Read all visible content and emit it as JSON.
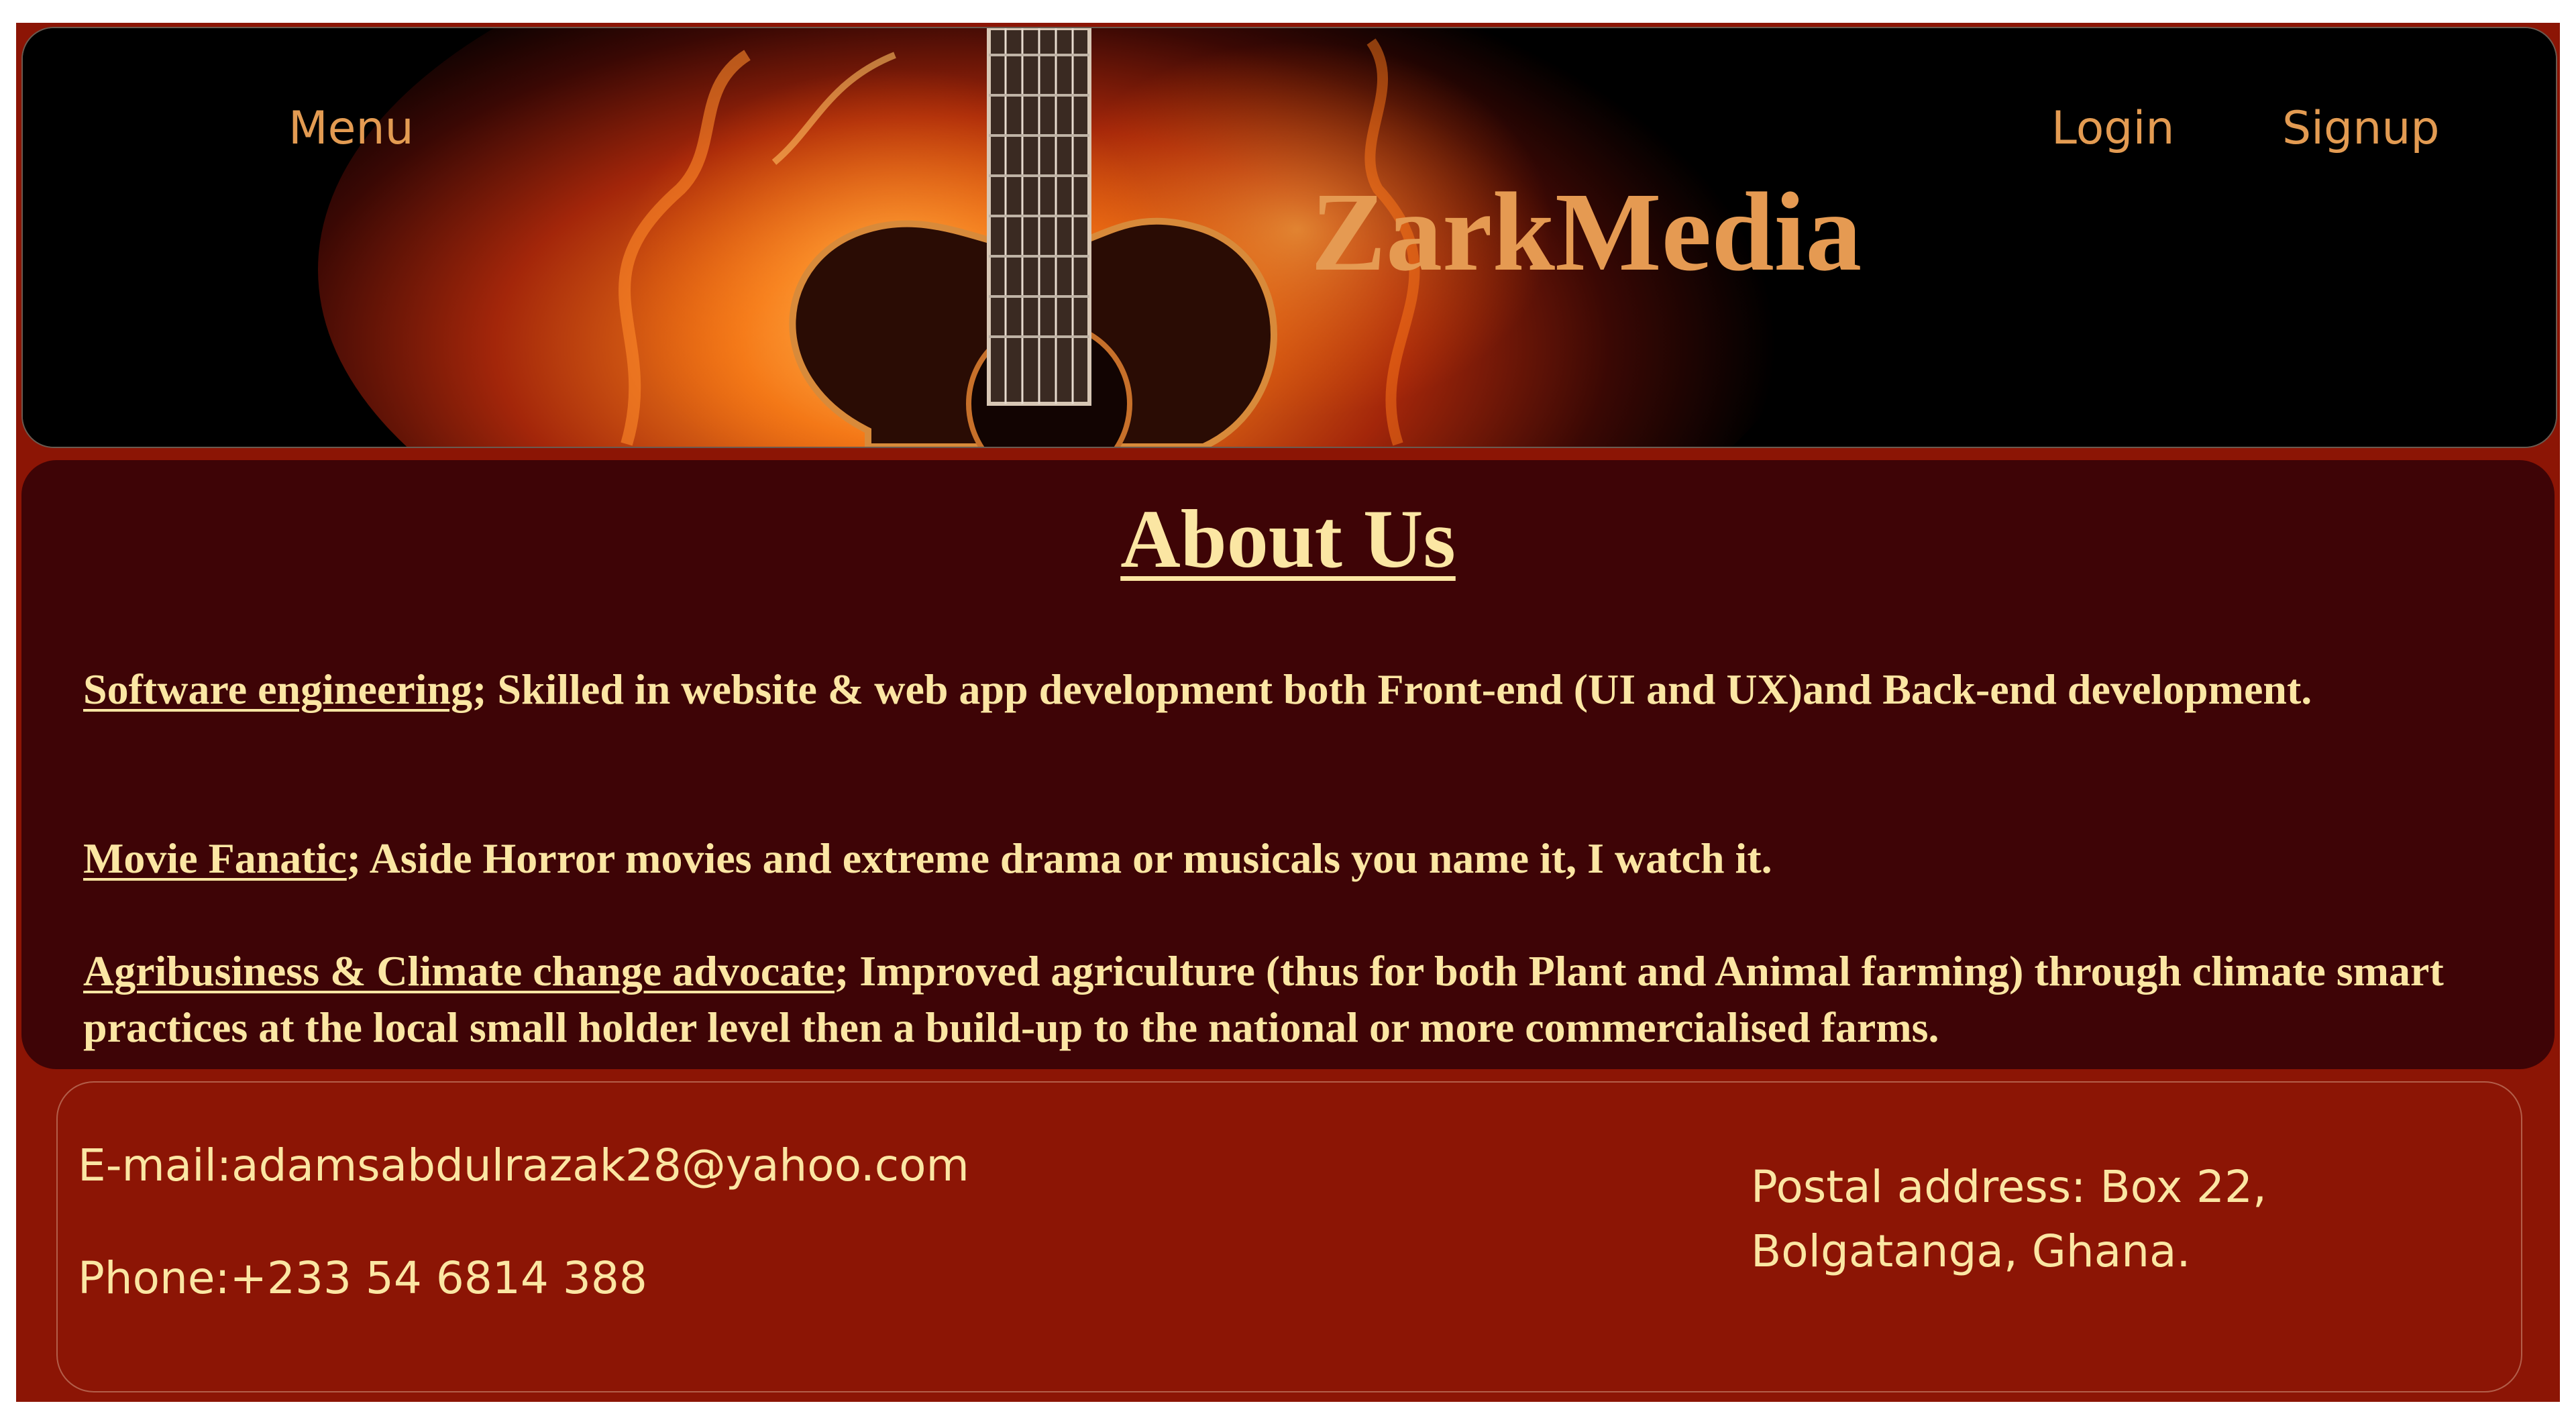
{
  "header": {
    "menu_label": "Menu",
    "login_label": "Login",
    "signup_label": "Signup",
    "brand": "ZarkMedia",
    "banner_image": "flaming-guitar"
  },
  "about": {
    "title": "About Us",
    "items": [
      {
        "lead": "Software engineering",
        "text": "; Skilled in website & web app development both Front-end (UI and UX)and Back-end development."
      },
      {
        "lead": "Movie Fanatic",
        "text": "; Aside Horror movies and extreme drama or musicals you name it, I watch it."
      },
      {
        "lead": "Agribusiness & Climate change advocate",
        "text": "; Improved agriculture (thus for both Plant and Animal farming) through climate smart practices at the local small holder level then a build-up to the national or more commercialised farms."
      }
    ]
  },
  "contact": {
    "email": "E-mail:adamsabdulrazak28@yahoo.com",
    "phone": "Phone:+233 54 6814 388",
    "postal": "Postal address: Box 22, Bolgatanga, Ghana."
  },
  "colors": {
    "page_background": "#8c1505",
    "about_background": "#3e0406",
    "text_cream": "#fbe6a3",
    "accent_orange": "#e39b52"
  }
}
